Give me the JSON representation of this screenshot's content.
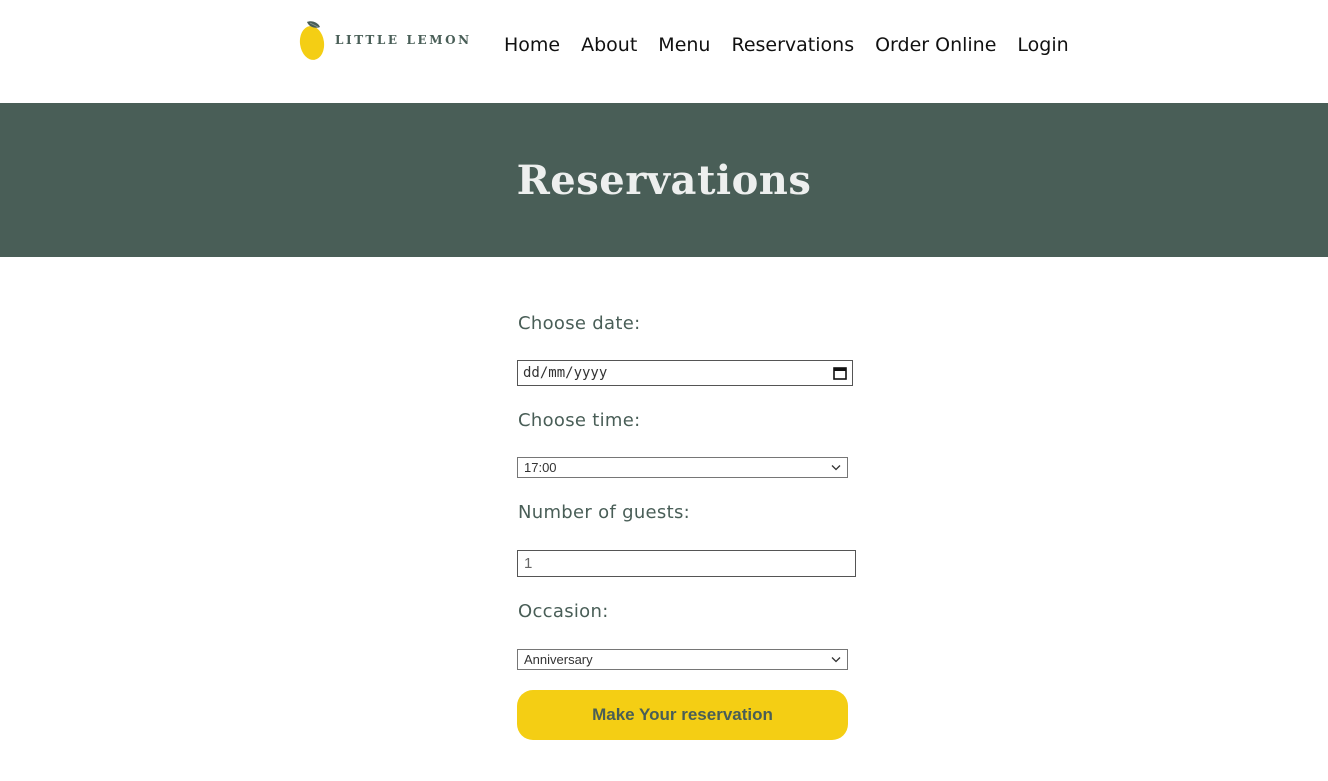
{
  "brand": {
    "name": "LITTLE LEMON",
    "icon": "lemon-icon",
    "colors": {
      "primary_green": "#495e57",
      "primary_yellow": "#f4ce14",
      "hero_text": "#edefee"
    }
  },
  "nav": {
    "items": [
      {
        "label": "Home"
      },
      {
        "label": "About"
      },
      {
        "label": "Menu"
      },
      {
        "label": "Reservations"
      },
      {
        "label": "Order Online"
      },
      {
        "label": "Login"
      }
    ]
  },
  "hero": {
    "title": "Reservations"
  },
  "form": {
    "date": {
      "label": "Choose date:",
      "placeholder": "dd/mm/yyyy",
      "icon": "calendar-icon"
    },
    "time": {
      "label": "Choose time:",
      "selected": "17:00"
    },
    "guests": {
      "label": "Number of guests:",
      "value": "1"
    },
    "occasion": {
      "label": "Occasion:",
      "selected": "Anniversary"
    },
    "submit_label": "Make Your reservation"
  }
}
